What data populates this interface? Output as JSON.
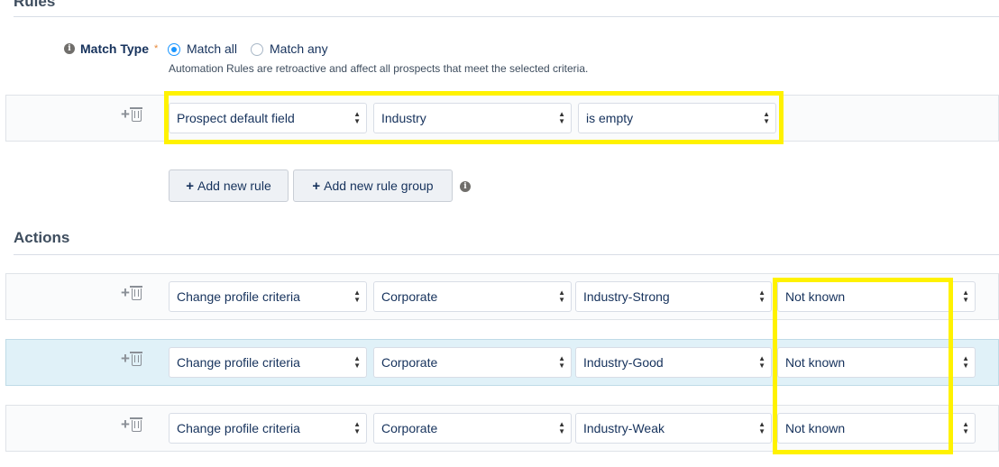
{
  "rules": {
    "section_title": "Rules",
    "match_type_label": "Match Type",
    "required_mark": "*",
    "match_all_label": "Match all",
    "match_any_label": "Match any",
    "selected": "match_all",
    "hint": "Automation Rules are retroactive and affect all prospects that meet the selected criteria.",
    "rule_row": {
      "field_type": "Prospect default field",
      "field": "Industry",
      "operator": "is empty"
    },
    "add_rule_label": "Add new rule",
    "add_rule_group_label": "Add new rule group"
  },
  "actions": {
    "section_title": "Actions",
    "rows": [
      {
        "action": "Change profile criteria",
        "profile": "Corporate",
        "criterion": "Industry-Strong",
        "value": "Not known",
        "active": false
      },
      {
        "action": "Change profile criteria",
        "profile": "Corporate",
        "criterion": "Industry-Good",
        "value": "Not known",
        "active": true
      },
      {
        "action": "Change profile criteria",
        "profile": "Corporate",
        "criterion": "Industry-Weak",
        "value": "Not known",
        "active": false
      }
    ]
  },
  "icons": {
    "info": "info-icon",
    "add": "plus-icon",
    "delete": "trash-icon",
    "select_arrows": "chevron-updown-icon"
  },
  "colors": {
    "highlight": "#fff200",
    "radio_selected": "#1b96ff",
    "active_row": "#e0f1f8"
  }
}
